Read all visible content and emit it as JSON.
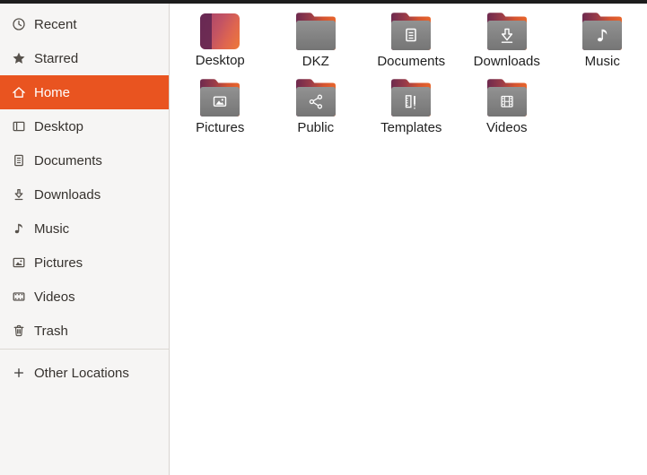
{
  "window": {
    "app": "Files",
    "top_edge_color": "#1d1d1d"
  },
  "colors": {
    "accent": "#e95420",
    "sidebar_bg": "#f6f5f4",
    "sidebar_border": "#d8d4d0",
    "main_bg": "#ffffff",
    "folder_front_top": "#929292",
    "folder_front_bottom": "#757575",
    "folder_back_maroon": "#6e2a4e",
    "folder_back_orange": "#e8662c",
    "desktop_icon_purple": "#5e2450",
    "desktop_icon_orange": "#ee7a38"
  },
  "sidebar": {
    "items": [
      {
        "label": "Recent",
        "icon": "recent-icon",
        "selected": false
      },
      {
        "label": "Starred",
        "icon": "star-icon",
        "selected": false
      },
      {
        "label": "Home",
        "icon": "home-icon",
        "selected": true
      },
      {
        "label": "Desktop",
        "icon": "desktop-icon",
        "selected": false
      },
      {
        "label": "Documents",
        "icon": "documents-icon",
        "selected": false
      },
      {
        "label": "Downloads",
        "icon": "downloads-icon",
        "selected": false
      },
      {
        "label": "Music",
        "icon": "music-icon",
        "selected": false
      },
      {
        "label": "Pictures",
        "icon": "pictures-icon",
        "selected": false
      },
      {
        "label": "Videos",
        "icon": "videos-icon",
        "selected": false
      },
      {
        "label": "Trash",
        "icon": "trash-icon",
        "selected": false
      }
    ],
    "other_locations": {
      "label": "Other Locations",
      "icon": "plus-icon"
    }
  },
  "files": {
    "view": "icon-grid",
    "items": [
      {
        "label": "Desktop",
        "icon": "desktop-gradient-icon",
        "emblem": null
      },
      {
        "label": "DKZ",
        "icon": "folder-icon",
        "emblem": null
      },
      {
        "label": "Documents",
        "icon": "folder-icon",
        "emblem": "document-emblem"
      },
      {
        "label": "Downloads",
        "icon": "folder-icon",
        "emblem": "download-emblem"
      },
      {
        "label": "Music",
        "icon": "folder-icon",
        "emblem": "music-emblem"
      },
      {
        "label": "Pictures",
        "icon": "folder-icon",
        "emblem": "picture-emblem"
      },
      {
        "label": "Public",
        "icon": "folder-icon",
        "emblem": "share-emblem"
      },
      {
        "label": "Templates",
        "icon": "folder-icon",
        "emblem": "template-emblem"
      },
      {
        "label": "Videos",
        "icon": "folder-icon",
        "emblem": "video-emblem"
      }
    ]
  }
}
